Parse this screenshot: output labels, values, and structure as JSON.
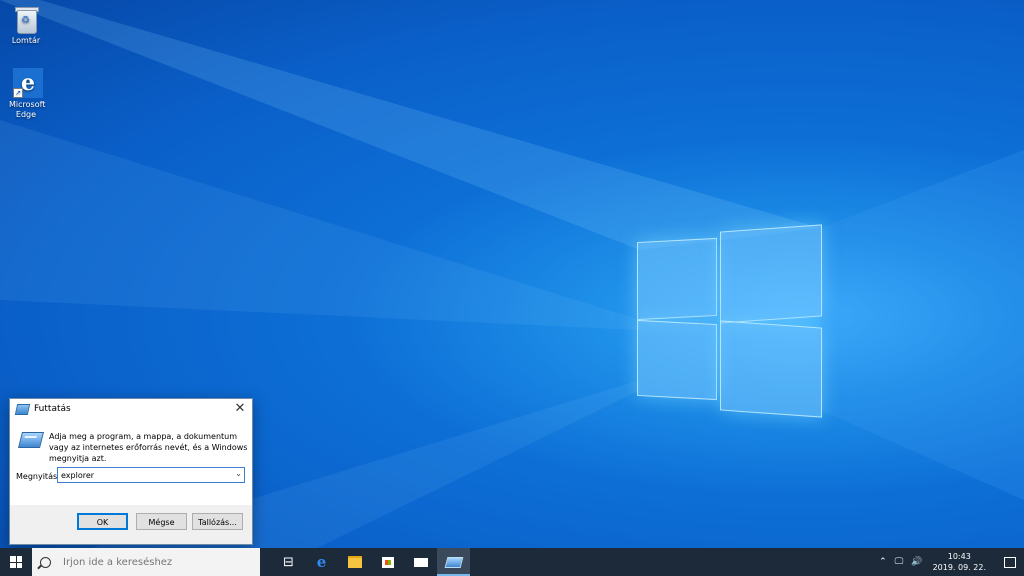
{
  "desktop": {
    "icons": [
      {
        "label": "Lomtár",
        "icon": "recycle-bin-icon"
      },
      {
        "label": "Microsoft Edge",
        "icon": "edge-icon"
      }
    ]
  },
  "run_dialog": {
    "title": "Futtatás",
    "close_glyph": "✕",
    "description": "Adja meg a program, a mappa, a dokumentum vagy az internetes erőforrás nevét, és a Windows megnyitja azt.",
    "open_label": "Megnyitás:",
    "open_value": "explorer",
    "ok_label": "OK",
    "cancel_label": "Mégse",
    "browse_label": "Tallózás..."
  },
  "taskbar": {
    "search_placeholder": "Írjon ide a kereséshez",
    "apps": [
      "task-view-icon",
      "edge-icon",
      "file-explorer-icon",
      "store-icon",
      "mail-icon",
      "run-icon"
    ],
    "active_app": "run-icon",
    "tray": {
      "time": "10:43",
      "date": "2019. 09. 22."
    }
  },
  "colors": {
    "accent": "#0078d7",
    "taskbar": "#1c2a3a",
    "wallpaper": "#0a5fc8"
  }
}
